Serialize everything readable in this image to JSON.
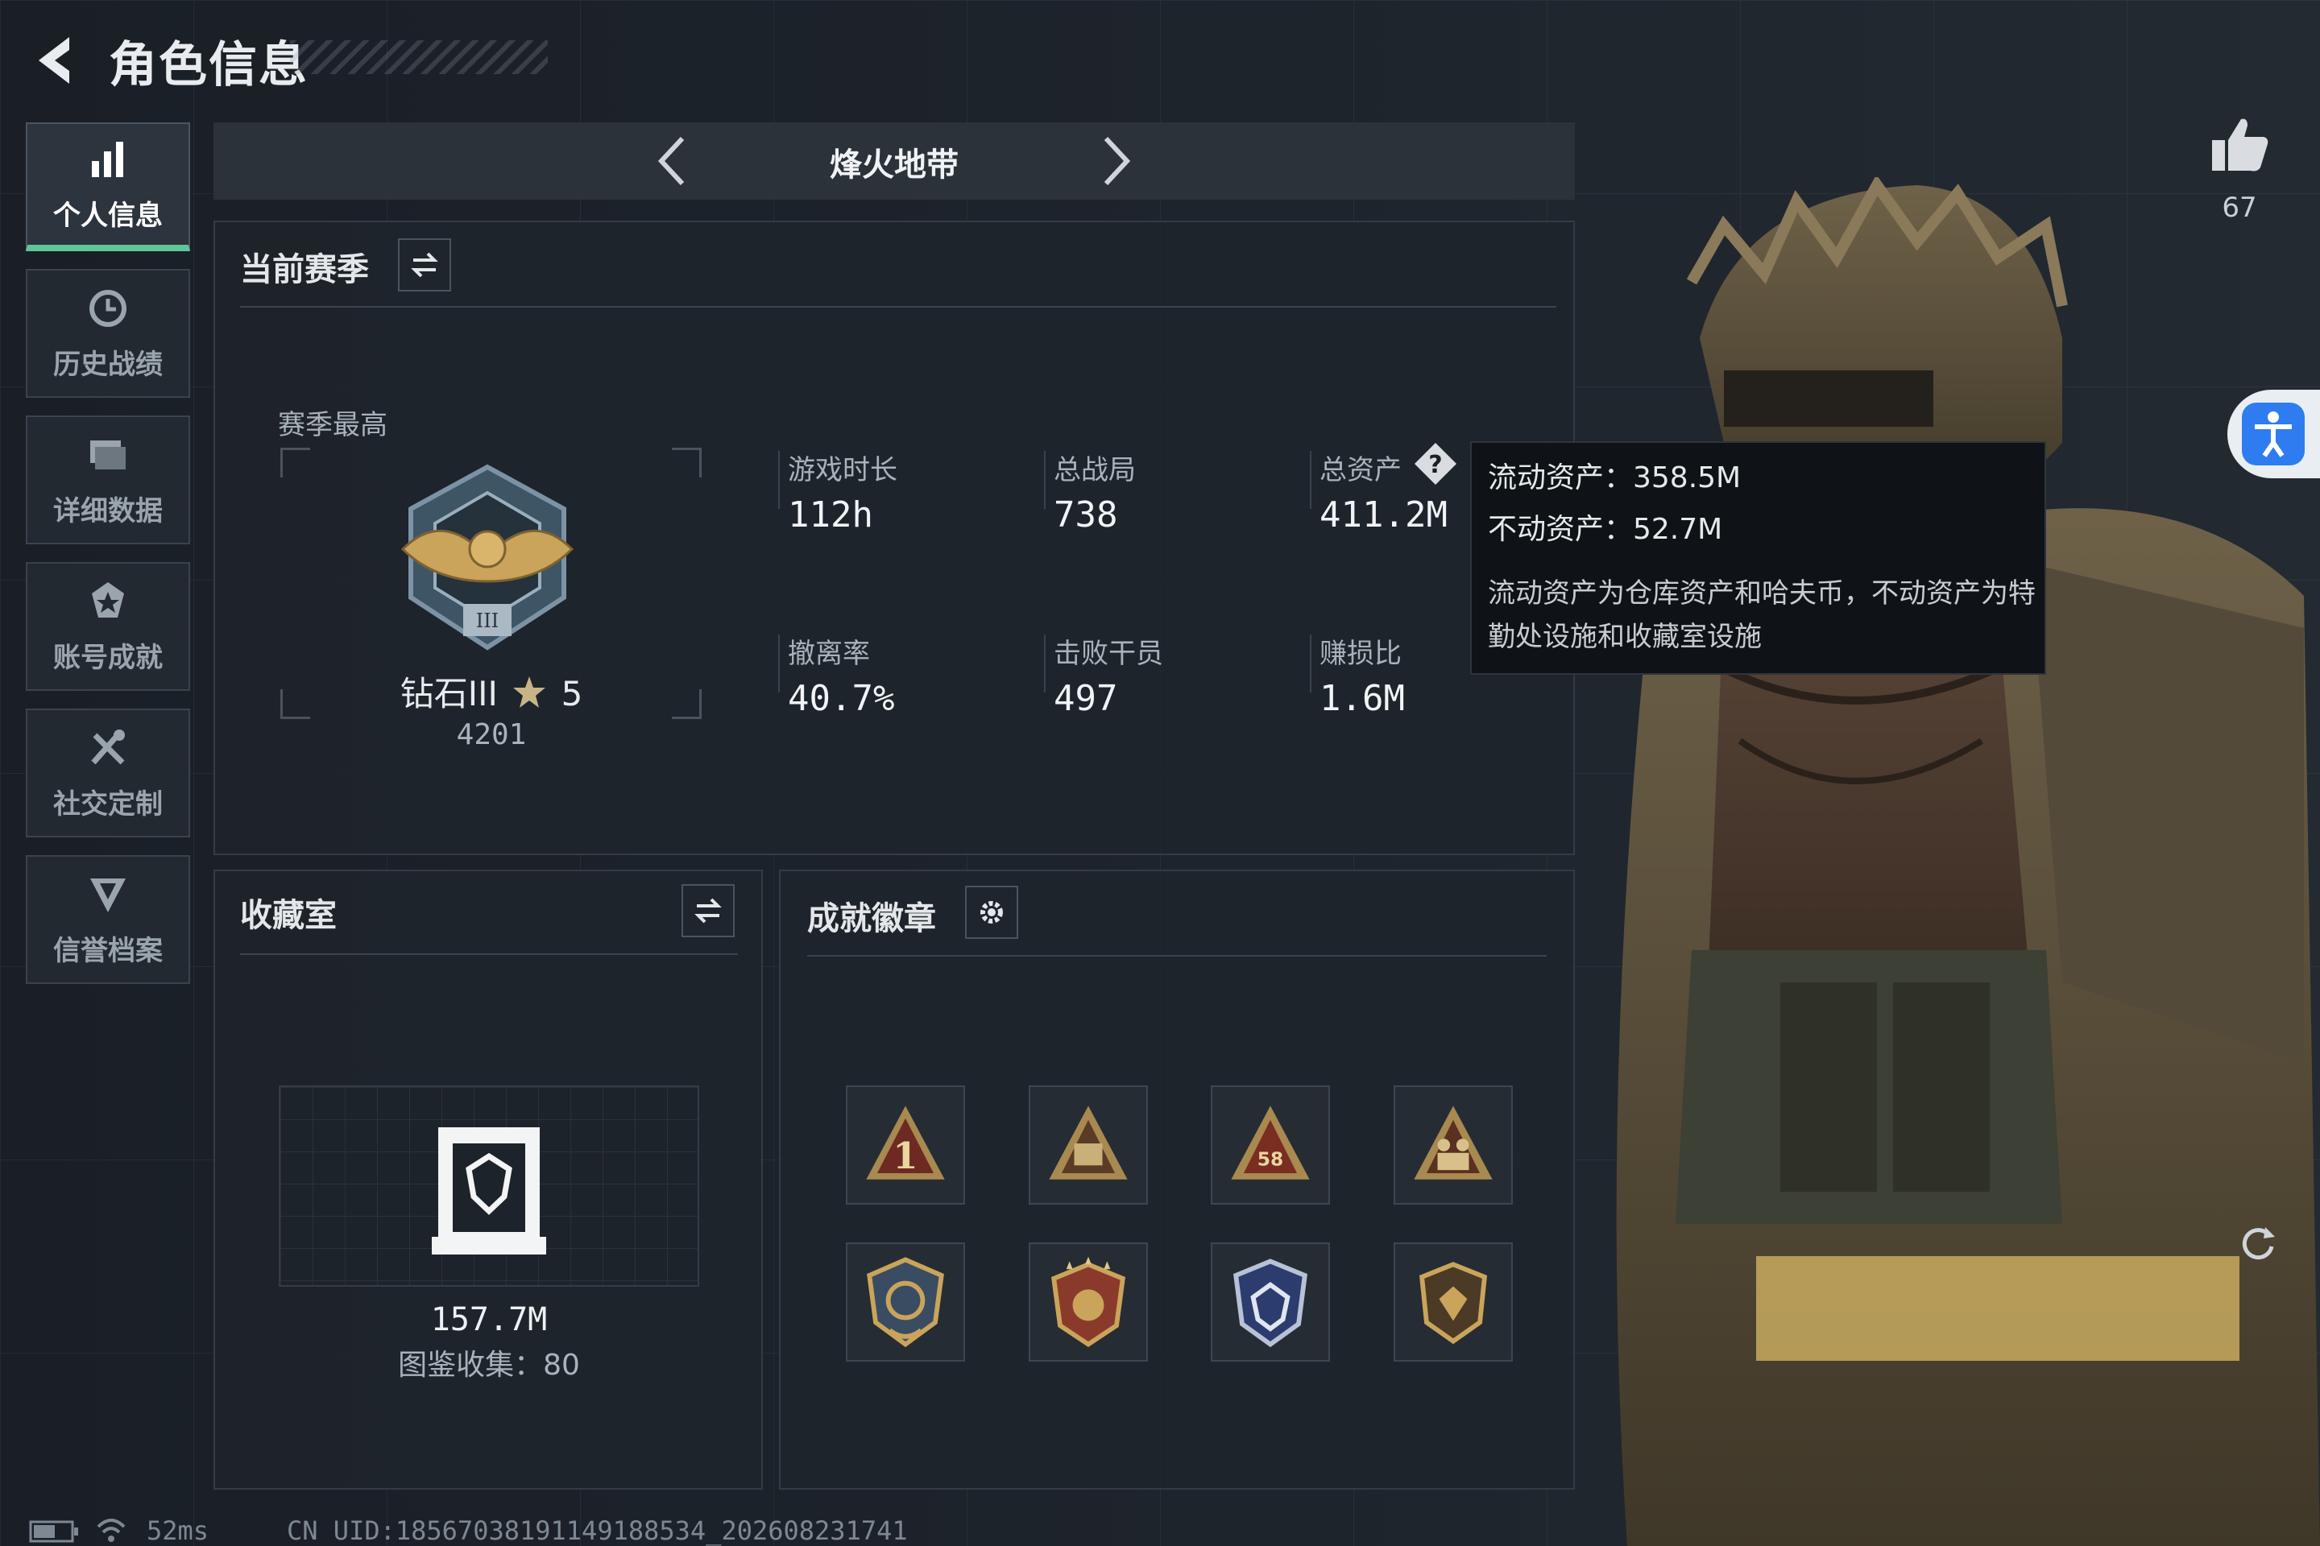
{
  "header": {
    "title": "角色信息"
  },
  "sidebar": {
    "items": [
      {
        "label": "个人信息",
        "icon": "bar-chart-icon",
        "active": true
      },
      {
        "label": "历史战绩",
        "icon": "history-clock-icon",
        "active": false
      },
      {
        "label": "详细数据",
        "icon": "folder-icon",
        "active": false
      },
      {
        "label": "账号成就",
        "icon": "medal-star-icon",
        "active": false
      },
      {
        "label": "社交定制",
        "icon": "tools-icon",
        "active": false
      },
      {
        "label": "信誉档案",
        "icon": "shield-v-icon",
        "active": false
      }
    ]
  },
  "mode": {
    "name": "烽火地带"
  },
  "season": {
    "title": "当前赛季",
    "best_label": "赛季最高",
    "rank_name": "钻石III",
    "rank_stars": "5",
    "rank_score": "4201",
    "stats": {
      "play_time_label": "游戏时长",
      "play_time": "112h",
      "total_matches_label": "总战局",
      "total_matches": "738",
      "total_assets_label": "总资产",
      "total_assets": "411.2M",
      "extract_rate_label": "撤离率",
      "extract_rate": "40.7%",
      "kills_label": "击败干员",
      "kills": "497",
      "profit_ratio_label": "赚损比",
      "profit_ratio": "1.6M"
    }
  },
  "tooltip": {
    "liquid": "流动资产：358.5M",
    "fixed": "不动资产：52.7M",
    "desc": "流动资产为仓库资产和哈夫币，不动资产为特勤处设施和收藏室设施"
  },
  "collection": {
    "title": "收藏室",
    "value": "157.7M",
    "codex": "图鉴收集：80"
  },
  "achievements": {
    "title": "成就徽章",
    "badges": [
      "badge-1",
      "badge-2",
      "badge-3",
      "badge-4",
      "badge-5",
      "badge-6",
      "badge-7",
      "badge-8"
    ]
  },
  "likes": {
    "count": "67"
  },
  "footer": {
    "ping": "52ms",
    "uid": "CN UID:18567038191149188534_202608231741"
  },
  "colors": {
    "accent": "#5fc59a",
    "tooltip_bg": "#0f1216",
    "panel_border": "#333b44"
  }
}
